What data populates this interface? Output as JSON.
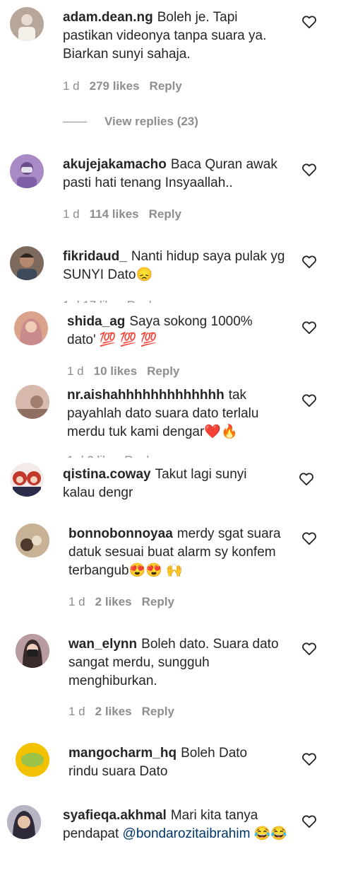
{
  "comments": [
    {
      "user": "adam.dean.ng",
      "text": "Boleh je. Tapi pastikan videonya tanpa suara ya. Biarkan sunyi sahaja.",
      "time": "1 d",
      "likes": "279 likes",
      "reply": "Reply",
      "avatar": "#b7a79a"
    },
    {
      "user": "akujejakamacho",
      "text": "Baca Quran awak pasti hati tenang Insyaallah..",
      "time": "1 d",
      "likes": "114 likes",
      "reply": "Reply",
      "avatar": "#a88ac4"
    },
    {
      "user": "fikridaud_",
      "text": "Nanti hidup saya pulak yg SUNYI Dato😞",
      "avatar": "#7e6a5c"
    },
    {
      "user": "shida_ag",
      "text": "Saya sokong 1000% dato' 💯 💯 💯",
      "time": "1 d",
      "likes": "10 likes",
      "reply": "Reply",
      "avatar": "#d9a38c"
    },
    {
      "user": "nr.aishahhhhhhhhhhhhh",
      "text": "tak payahlah dato suara dato terlalu merdu tuk kami dengar❤️🔥",
      "avatar": "#c9a8a0"
    },
    {
      "user": "qistina.coway",
      "text": "Takut lagi sunyi kalau dengr",
      "avatar": "#c0392b"
    },
    {
      "user": "bonnobonnoyaa",
      "text": "merdy sgat suara datuk sesuai buat alarm sy konfem terbangub😍😍 🙌",
      "time": "1 d",
      "likes": "2 likes",
      "reply": "Reply",
      "avatar": "#b49d82"
    },
    {
      "user": "wan_elynn",
      "text": "Boleh dato. Suara dato sangat merdu, sungguh menghiburkan.",
      "time": "1 d",
      "likes": "2 likes",
      "reply": "Reply",
      "avatar": "#9d7f86"
    },
    {
      "user": "mangocharm_hq",
      "text": "Boleh Dato rindu suara Dato",
      "avatar": "#f2c200"
    },
    {
      "user": "syafieqa.akhmal",
      "text_before": "Mari kita tanya pendapat ",
      "mention": "@bondarozitaibrahim",
      "text_after": " 😂😂",
      "avatar": "#8a7f96"
    }
  ],
  "view_replies": "View replies (23)",
  "icons": {
    "heart": "heart-icon"
  }
}
